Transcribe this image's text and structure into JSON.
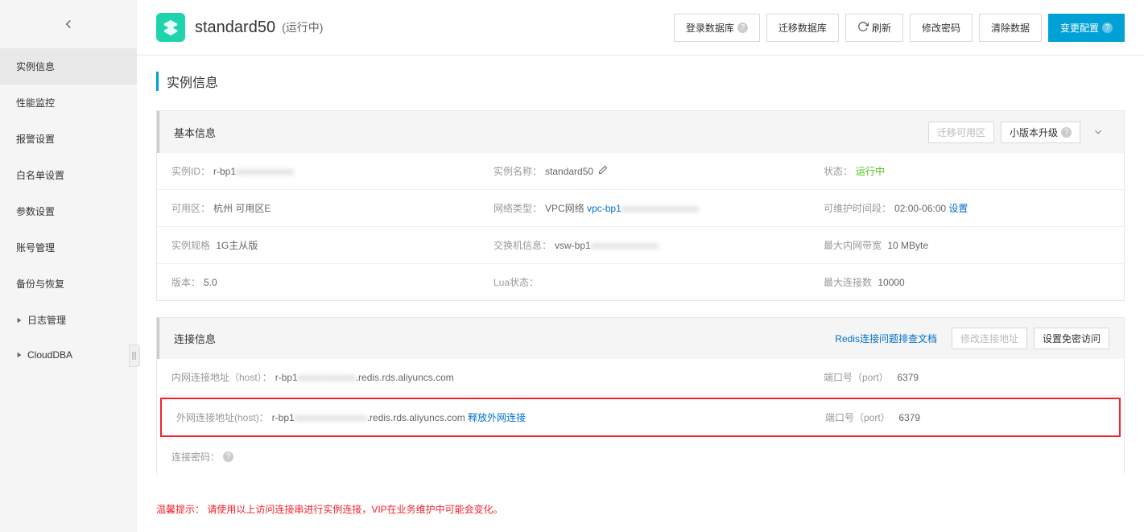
{
  "header": {
    "title": "standard50",
    "status": "(运行中)"
  },
  "actions": {
    "login_db": "登录数据库",
    "migrate_db": "迁移数据库",
    "refresh": "刷新",
    "change_pwd": "修改密码",
    "clear_data": "清除数据",
    "change_config": "变更配置"
  },
  "sidebar": {
    "items": [
      "实例信息",
      "性能监控",
      "报警设置",
      "白名单设置",
      "参数设置",
      "账号管理",
      "备份与恢复",
      "日志管理",
      "CloudDBA"
    ]
  },
  "section_title": "实例信息",
  "basic_info": {
    "header": "基本信息",
    "migrate_zone": "迁移可用区",
    "minor_upgrade": "小版本升级",
    "rows": {
      "instance_id_label": "实例ID：",
      "instance_id_value": "r-bp1",
      "instance_name_label": "实例名称：",
      "instance_name_value": "standard50",
      "status_label": "状态：",
      "status_value": "运行中",
      "zone_label": "可用区：",
      "zone_value": "杭州 可用区E",
      "network_type_label": "网络类型：",
      "network_type_value": "VPC网络",
      "network_vpc": "vpc-bp1",
      "maint_label": "可维护时间段：",
      "maint_value": "02:00-06:00",
      "maint_set": "设置",
      "spec_label": "实例规格",
      "spec_value": "1G主从版",
      "switch_label": "交换机信息：",
      "switch_value": "vsw-bp1",
      "bandwidth_label": "最大内网带宽",
      "bandwidth_value": "10 MByte",
      "version_label": "版本：",
      "version_value": "5.0",
      "lua_label": "Lua状态：",
      "maxconn_label": "最大连接数",
      "maxconn_value": "10000"
    }
  },
  "conn_info": {
    "header": "连接信息",
    "troubleshoot": "Redis连接问题排查文档",
    "modify_addr": "修改连接地址",
    "set_pwdless": "设置免密访问",
    "internal_label": "内网连接地址（host）：",
    "internal_prefix": "r-bp1",
    "internal_suffix": ".redis.rds.aliyuncs.com",
    "public_label": "外网连接地址(host)：",
    "public_prefix": "r-bp1",
    "public_suffix": ".redis.rds.aliyuncs.com",
    "release_public": "释放外网连接",
    "port_label": "端口号（port）",
    "port_value": "6379",
    "pwd_label": "连接密码：",
    "warning": "温馨提示： 请使用以上访问连接串进行实例连接，VIP在业务维护中可能会变化。"
  }
}
